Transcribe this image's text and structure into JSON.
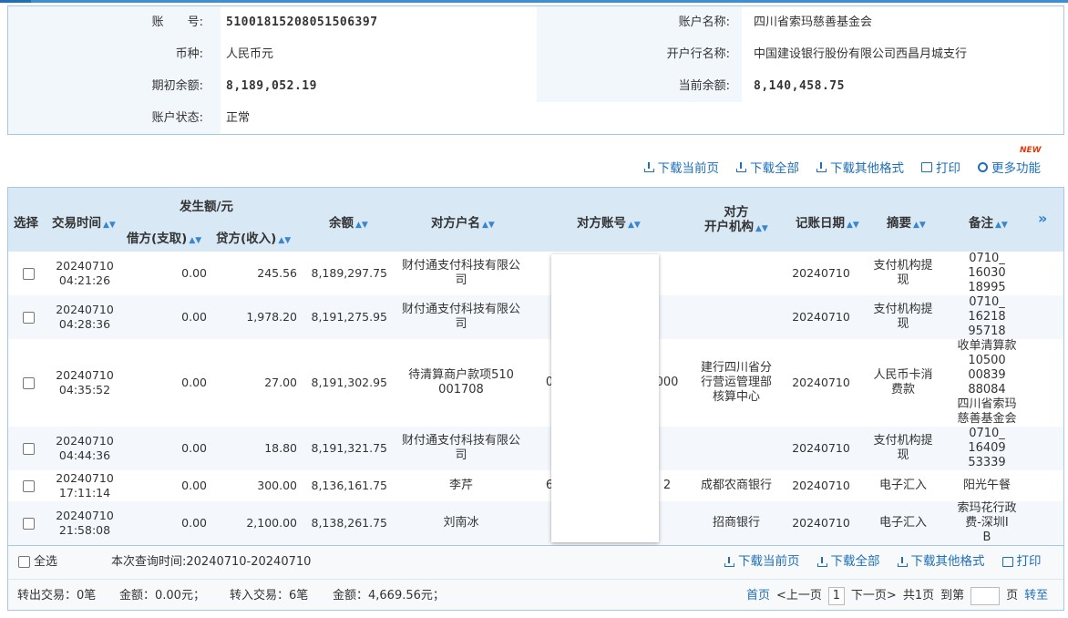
{
  "account": {
    "acct_no_label": "账　　号:",
    "acct_no": "51001815208051506397",
    "acct_name_label": "账户名称:",
    "acct_name": "四川省索玛慈善基金会",
    "currency_label": "币种:",
    "currency": "人民币元",
    "bank_label": "开户行名称:",
    "bank": "中国建设银行股份有限公司西昌月城支行",
    "open_bal_label": "期初余额:",
    "open_bal": "8,189,052.19",
    "cur_bal_label": "当前余额:",
    "cur_bal": "8,140,458.75",
    "status_label": "账户状态:",
    "status": "正常"
  },
  "toolbar": {
    "download_page": "下载当前页",
    "download_all": "下载全部",
    "download_other": "下载其他格式",
    "print": "打印",
    "more": "更多功能",
    "new_badge": "NEW"
  },
  "table": {
    "headers": {
      "select": "选择",
      "time": "交易时间",
      "amount_group": "发生额/元",
      "debit": "借方(支取)",
      "credit": "贷方(收入)",
      "balance": "余额",
      "cp_name": "对方户名",
      "cp_account": "对方账号",
      "cp_bank_1": "对方",
      "cp_bank_2": "开户机构",
      "post_date": "记账日期",
      "summary": "摘要",
      "remark": "备注",
      "more": "»"
    },
    "rows": [
      {
        "date": "20240710",
        "time": "04:21:26",
        "debit": "0.00",
        "credit": "245.56",
        "balance": "8,189,297.75",
        "cp_name_1": "财付通支付科技有限公",
        "cp_name_2": "司",
        "cp_acct_l": "",
        "cp_acct_r": "",
        "cp_bank_1": "",
        "cp_bank_2": "",
        "cp_bank_3": "",
        "cp_bank_4": "",
        "post": "20240710",
        "sum_1": "支付机构提",
        "sum_2": "现",
        "rem_1": "0710_",
        "rem_2": "16030",
        "rem_3": "18995",
        "rem_4": "",
        "rem_5": "",
        "rem_6": ""
      },
      {
        "date": "20240710",
        "time": "04:28:36",
        "debit": "0.00",
        "credit": "1,978.20",
        "balance": "8,191,275.95",
        "cp_name_1": "财付通支付科技有限公",
        "cp_name_2": "司",
        "cp_acct_l": "",
        "cp_acct_r": "",
        "cp_bank_1": "",
        "cp_bank_2": "",
        "cp_bank_3": "",
        "cp_bank_4": "",
        "post": "20240710",
        "sum_1": "支付机构提",
        "sum_2": "现",
        "rem_1": "0710_",
        "rem_2": "16218",
        "rem_3": "95718",
        "rem_4": "",
        "rem_5": "",
        "rem_6": ""
      },
      {
        "date": "20240710",
        "time": "04:35:52",
        "debit": "0.00",
        "credit": "27.00",
        "balance": "8,191,302.95",
        "cp_name_1": "待清算商户款项510",
        "cp_name_2": "001708",
        "cp_acct_l": "0",
        "cp_acct_r": "000",
        "cp_bank_1": "建行四川省分",
        "cp_bank_2": "行营运管理部",
        "cp_bank_3": "核算中心",
        "cp_bank_4": "",
        "post": "20240710",
        "sum_1": "人民币卡消",
        "sum_2": "费款",
        "rem_1": "收单清算款",
        "rem_2": "10500",
        "rem_3": "00839",
        "rem_4": "88084",
        "rem_5": "四川省索玛",
        "rem_6": "慈善基金会"
      },
      {
        "date": "20240710",
        "time": "04:44:36",
        "debit": "0.00",
        "credit": "18.80",
        "balance": "8,191,321.75",
        "cp_name_1": "财付通支付科技有限公",
        "cp_name_2": "司",
        "cp_acct_l": "",
        "cp_acct_r": "",
        "cp_bank_1": "",
        "cp_bank_2": "",
        "cp_bank_3": "",
        "cp_bank_4": "",
        "post": "20240710",
        "sum_1": "支付机构提",
        "sum_2": "现",
        "rem_1": "0710_",
        "rem_2": "16409",
        "rem_3": "53339",
        "rem_4": "",
        "rem_5": "",
        "rem_6": ""
      },
      {
        "date": "20240710",
        "time": "17:11:14",
        "debit": "0.00",
        "credit": "300.00",
        "balance": "8,136,161.75",
        "cp_name_1": "李芹",
        "cp_name_2": "",
        "cp_acct_l": "6",
        "cp_acct_r": "2",
        "cp_bank_1": "成都农商银行",
        "cp_bank_2": "",
        "cp_bank_3": "",
        "cp_bank_4": "",
        "post": "20240710",
        "sum_1": "电子汇入",
        "sum_2": "",
        "rem_1": "阳光午餐",
        "rem_2": "",
        "rem_3": "",
        "rem_4": "",
        "rem_5": "",
        "rem_6": ""
      },
      {
        "date": "20240710",
        "time": "21:58:08",
        "debit": "0.00",
        "credit": "2,100.00",
        "balance": "8,138,261.75",
        "cp_name_1": "刘南冰",
        "cp_name_2": "",
        "cp_acct_l": "",
        "cp_acct_r": "",
        "cp_bank_1": "招商银行",
        "cp_bank_2": "",
        "cp_bank_3": "",
        "cp_bank_4": "",
        "post": "20240710",
        "sum_1": "电子汇入",
        "sum_2": "",
        "rem_1": "索玛花行政",
        "rem_2": "费-深圳I",
        "rem_3": "B",
        "rem_4": "",
        "rem_5": "",
        "rem_6": ""
      }
    ]
  },
  "footer": {
    "select_all": "全选",
    "query_time": "本次查询时间:20240710-20240710",
    "download_page": "下载当前页",
    "download_all": "下载全部",
    "download_other": "下载其他格式",
    "print": "打印",
    "out_tx": "转出交易：0笔",
    "out_amount": "金额：0.00元；",
    "in_tx": "转入交易：6笔",
    "in_amount": "金额：4,669.56元；",
    "first": "首页",
    "prev": "<上一页",
    "page": "1",
    "next": "下一页>",
    "total": "共1页",
    "goto": "到第",
    "page_unit": "页",
    "go": "转至"
  }
}
